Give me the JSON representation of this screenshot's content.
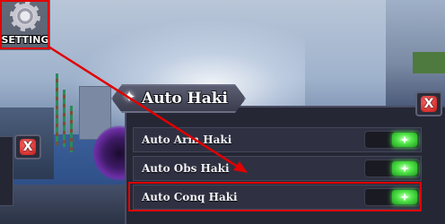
{
  "setting_button": {
    "label": "SETTING",
    "icon": "gear-icon"
  },
  "panel": {
    "title": "Auto Haki",
    "title_icon": "star-icon",
    "close_icon": "close-icon",
    "close_glyph": "X",
    "rows": [
      {
        "label": "Auto Arm Haki",
        "enabled": true
      },
      {
        "label": "Auto Obs Haki",
        "enabled": true
      },
      {
        "label": "Auto Conq Haki",
        "enabled": true
      }
    ]
  },
  "side_panel": {
    "close_glyph": "X"
  },
  "annotation": {
    "highlight_color": "#e00000",
    "toggle_on_color": "#53e84a"
  }
}
